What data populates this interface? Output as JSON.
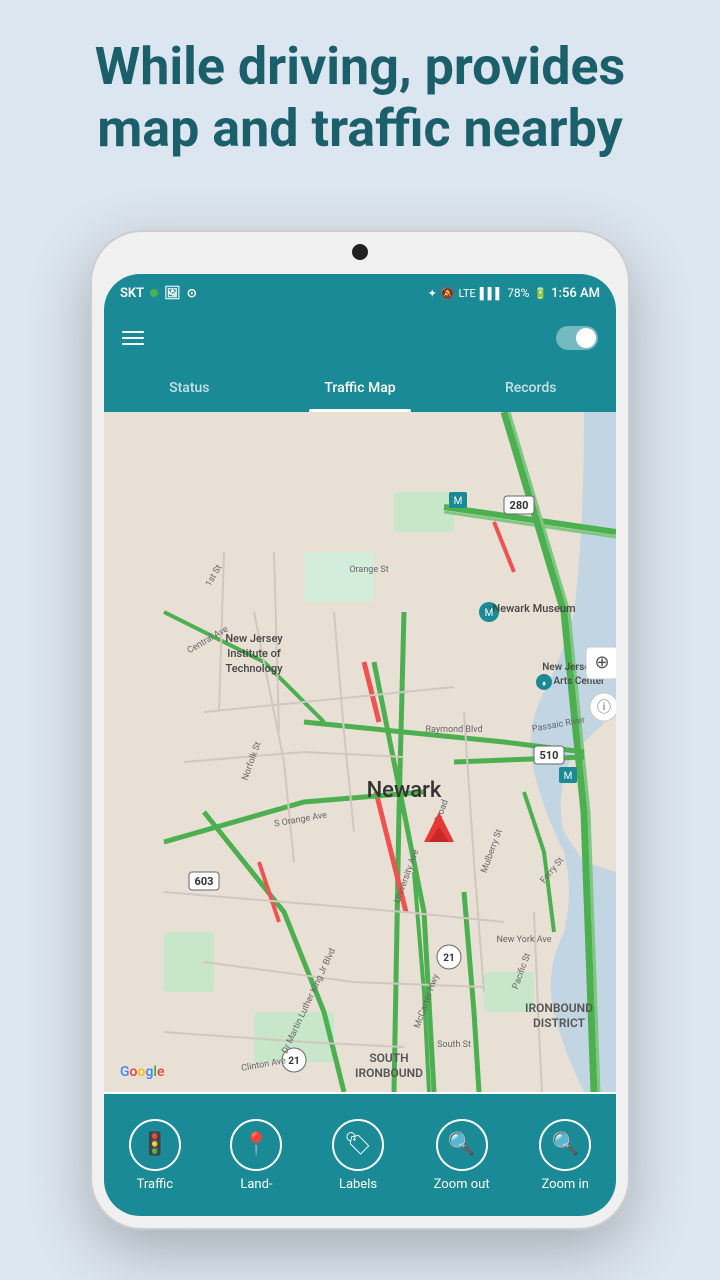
{
  "header": {
    "line1": "While driving, provides",
    "line2": "map and traffic nearby"
  },
  "statusBar": {
    "carrier": "SKT",
    "time": "1:56 AM",
    "battery": "78%",
    "signal": "LTE"
  },
  "tabs": {
    "items": [
      {
        "label": "Status",
        "active": false
      },
      {
        "label": "Traffic Map",
        "active": true
      },
      {
        "label": "Records",
        "active": false
      }
    ]
  },
  "map": {
    "city": "Newark",
    "neighborhoods": [
      "IRONBOUND DISTRICT",
      "SOUTH IRONBOUND"
    ],
    "landmarks": [
      "New Jersey Institute of Technology",
      "Newark Museum",
      "New Jersey Perf Arts Center"
    ],
    "roads": [
      "280",
      "510",
      "603",
      "21"
    ],
    "googleLogo": "Google"
  },
  "bottomNav": {
    "items": [
      {
        "label": "Traffic",
        "icon": "🚦"
      },
      {
        "label": "Land-",
        "icon": "📍"
      },
      {
        "label": "Labels",
        "icon": "🏷"
      },
      {
        "label": "Zoom out",
        "icon": "🔍"
      },
      {
        "label": "Zoom in",
        "icon": "🔍"
      }
    ]
  }
}
